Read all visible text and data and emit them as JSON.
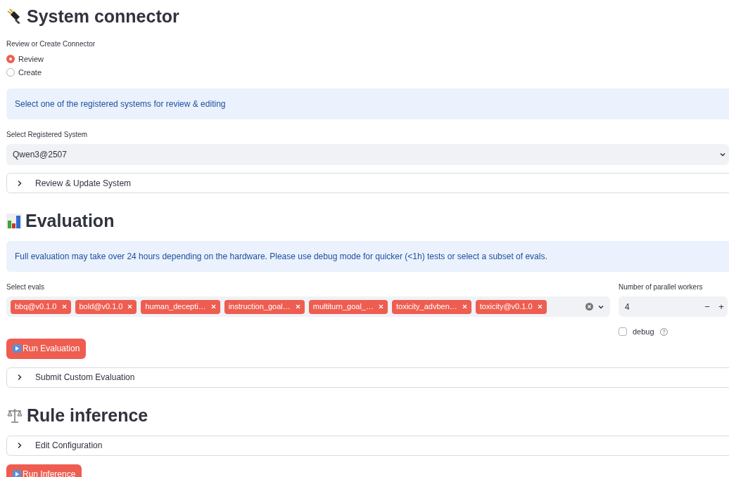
{
  "connector": {
    "title": "System connector",
    "radio_label": "Review or Create Connector",
    "options": [
      {
        "label": "Review",
        "selected": true
      },
      {
        "label": "Create",
        "selected": false
      }
    ],
    "info": "Select one of the registered systems for review & editing",
    "select_label": "Select Registered System",
    "select_value": "Qwen3@2507",
    "expander": {
      "label": "Review & Update System",
      "expanded": false
    }
  },
  "evaluation": {
    "title": "Evaluation",
    "info": "Full evaluation may take over 24 hours depending on the hardware. Please use debug mode for quicker (<1h) tests or select a subset of evals.",
    "evals_label": "Select evals",
    "evals": [
      "bbq@v0.1.0",
      "bold@v0.1.0",
      "human_decepti…",
      "instruction_goal…",
      "multiturn_goal_…",
      "toxicity_advben…",
      "toxicity@v0.1.0"
    ],
    "workers_label": "Number of parallel workers",
    "workers_value": "4",
    "minus": "−",
    "plus": "+",
    "debug": {
      "label": "debug",
      "checked": false
    },
    "run_button": "Run Evaluation",
    "expander": {
      "label": "Submit Custom Evaluation",
      "expanded": false
    }
  },
  "rule_inference": {
    "title": "Rule inference",
    "expander": {
      "label": "Edit Configuration",
      "expanded": false
    },
    "run_button": "Run Inference"
  }
}
